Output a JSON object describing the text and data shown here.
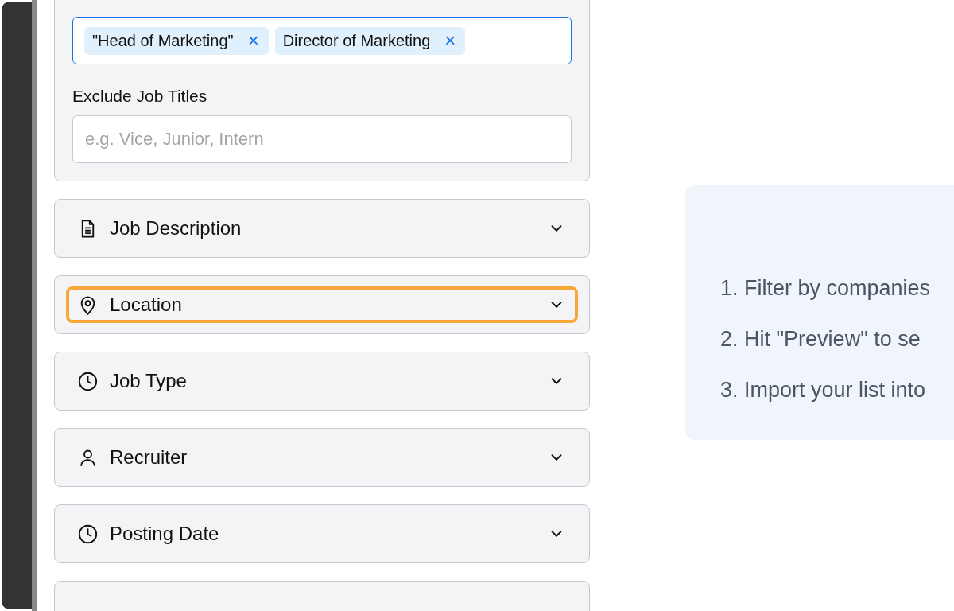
{
  "include_job_titles": {
    "tags": [
      {
        "text": "\"Head of Marketing\"",
        "remove": "×"
      },
      {
        "text": "Director of Marketing",
        "remove": "×"
      }
    ],
    "focused": true
  },
  "exclude_job_titles": {
    "label": "Exclude Job Titles",
    "placeholder": "e.g. Vice, Junior, Intern"
  },
  "sections": [
    {
      "title": "Job Description",
      "kind": "description",
      "focused": false,
      "expanded": false
    },
    {
      "title": "Location",
      "kind": "location",
      "focused": true,
      "expanded": false
    },
    {
      "title": "Job Type",
      "kind": "time",
      "focused": false,
      "expanded": false
    },
    {
      "title": "Recruiter",
      "kind": "person",
      "focused": false,
      "expanded": false
    },
    {
      "title": "Posting Date",
      "kind": "time",
      "focused": false,
      "expanded": false
    }
  ],
  "steps": [
    "1. Filter by companies",
    "2. Hit \"Preview\" to se",
    "3. Import your list into"
  ]
}
